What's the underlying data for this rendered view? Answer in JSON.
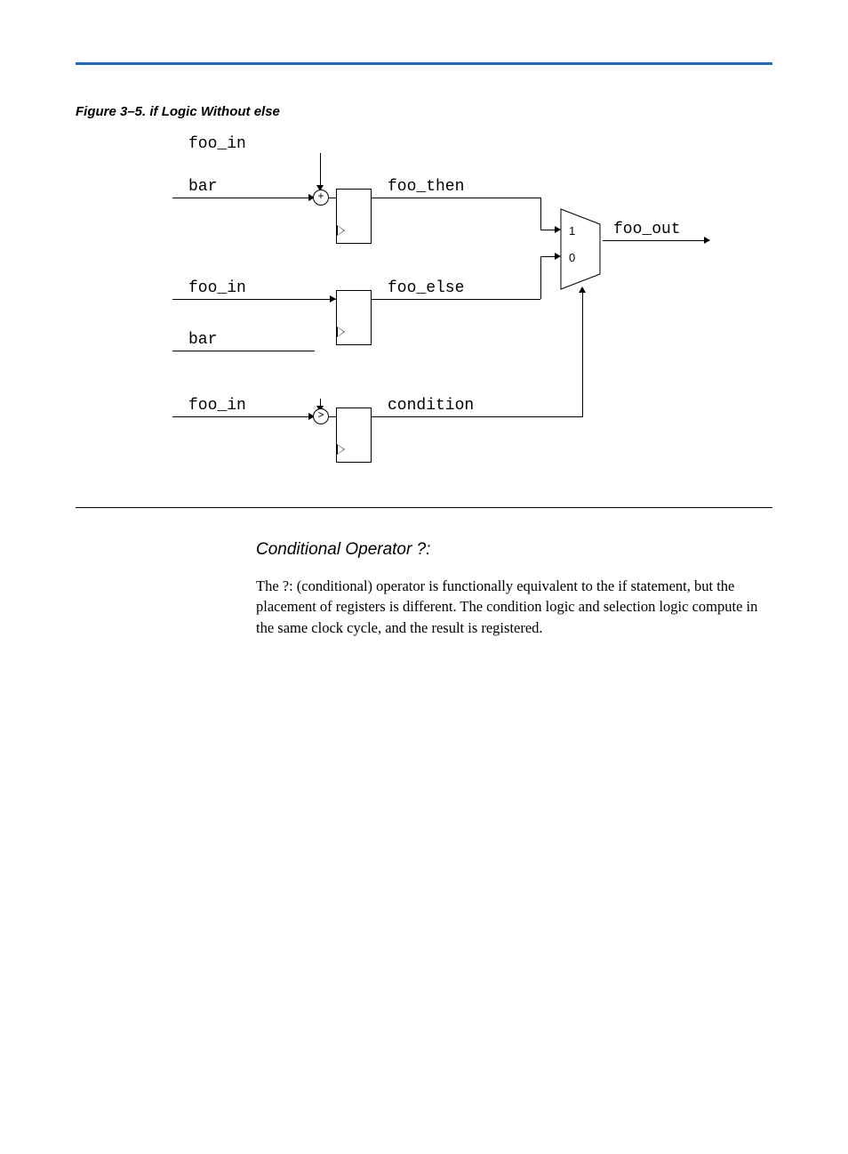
{
  "figure_caption": "Figure 3–5. if Logic Without else",
  "diagram": {
    "labels": {
      "foo_in_top": "foo_in",
      "bar_top": "bar",
      "foo_then": "foo_then",
      "foo_out": "foo_out",
      "foo_in_mid": "foo_in",
      "foo_else": "foo_else",
      "bar_mid": "bar",
      "foo_in_bot": "foo_in",
      "condition": "condition"
    },
    "mux": {
      "one": "1",
      "zero": "0"
    },
    "ops": {
      "add": "+",
      "gt": ">"
    }
  },
  "section_heading": "Conditional Operator ?:",
  "body_para": "The ?: (conditional) operator is functionally equivalent to the if statement, but the placement of registers is different. The condition logic and selection logic compute in the same clock cycle, and the result is registered."
}
